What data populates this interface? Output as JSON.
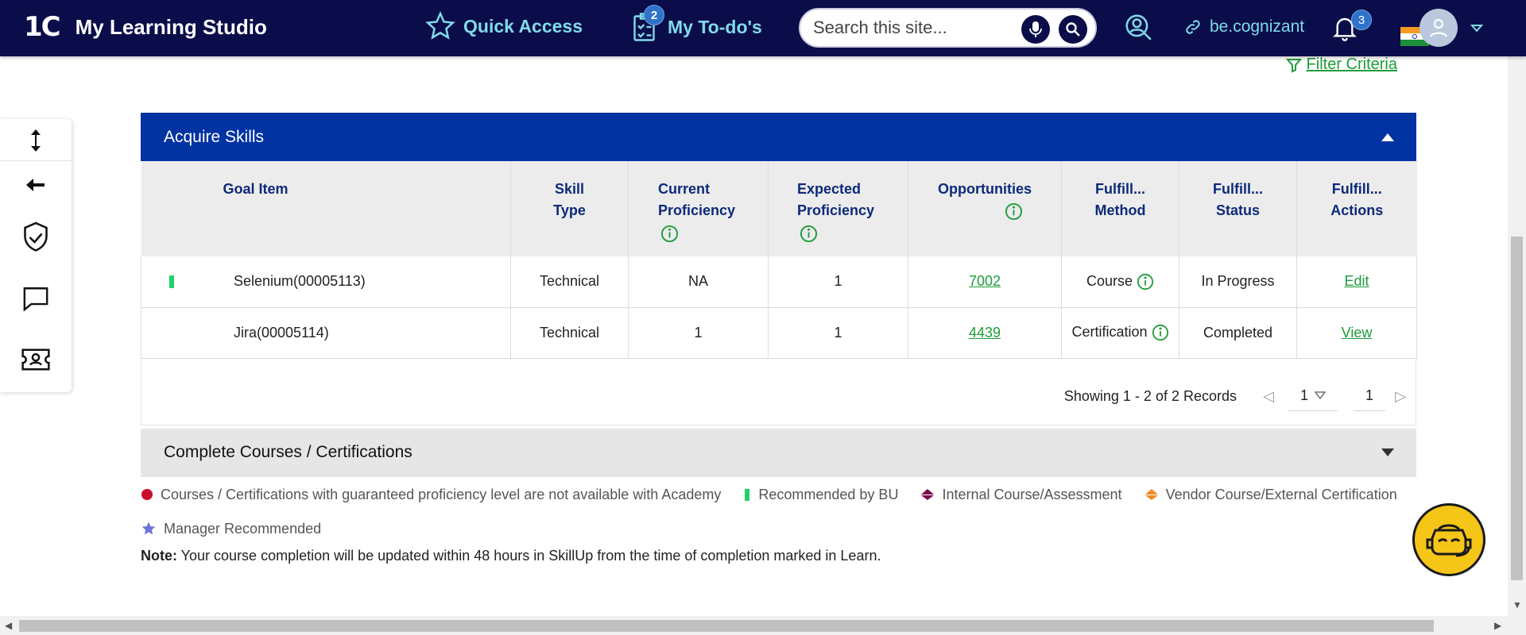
{
  "header": {
    "logo_mark": "1C",
    "app_title": "My Learning Studio",
    "quick_access": "Quick Access",
    "todo_label": "My To-do's",
    "todo_count": "2",
    "search_placeholder": "Search this site...",
    "link_label": "be.cognizant",
    "notification_count": "3"
  },
  "filter_label": "Filter Criteria",
  "section1": {
    "title": "Acquire Skills",
    "columns": [
      {
        "line1": "Goal Item",
        "line2": ""
      },
      {
        "line1": "Skill",
        "line2": "Type"
      },
      {
        "line1": "Current",
        "line2": "Proficiency"
      },
      {
        "line1": "Expected",
        "line2": "Proficiency"
      },
      {
        "line1": "Opportunities",
        "line2": ""
      },
      {
        "line1": "Fulfill...",
        "line2": "Method"
      },
      {
        "line1": "Fulfill...",
        "line2": "Status"
      },
      {
        "line1": "Fulfill...",
        "line2": "Actions"
      }
    ],
    "rows": [
      {
        "goal": "Selenium(00005113)",
        "skill_type": "Technical",
        "current": "NA",
        "expected": "1",
        "opportunities": "7002",
        "method": "Course",
        "status": "In Progress",
        "action": "Edit"
      },
      {
        "goal": "Jira(00005114)",
        "skill_type": "Technical",
        "current": "1",
        "expected": "1",
        "opportunities": "4439",
        "method": "Certification",
        "status": "Completed",
        "action": "View"
      }
    ],
    "pager": {
      "records": "Showing 1 - 2 of 2 Records",
      "page_select": "1",
      "page_input": "1"
    }
  },
  "section2": {
    "title": "Complete Courses / Certifications"
  },
  "legend": {
    "guaranteed": "Courses / Certifications with guaranteed proficiency level are not available with Academy",
    "recommended_bu": "Recommended by BU",
    "internal": "Internal Course/Assessment",
    "vendor": "Vendor Course/External Certification",
    "manager": "Manager Recommended"
  },
  "note": {
    "label": "Note:",
    "text": " Your course completion will be updated within 48 hours in SkillUp from the time of completion marked in Learn."
  },
  "colors": {
    "header_bg": "#0b0d4a",
    "nav_accent": "#7fdbe8",
    "panel_blue": "#0133a3",
    "link_green": "#1f9c3b",
    "recommended_green": "#21d16b"
  },
  "icons": [
    "star-icon",
    "clipboard-check-icon",
    "mic-icon",
    "search-icon",
    "user-search-icon",
    "link-icon",
    "bell-icon",
    "india-flag-icon",
    "avatar-icon",
    "chevron-down-icon",
    "filter-icon",
    "expand-vertical-icon",
    "arrow-left-icon",
    "shield-check-icon",
    "chat-icon",
    "support-ticket-icon",
    "info-icon",
    "chatbot-icon"
  ]
}
